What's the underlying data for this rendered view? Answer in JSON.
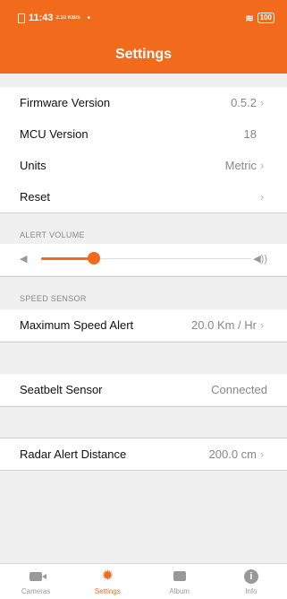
{
  "status_bar": {
    "time": "11:43",
    "net_speed": "2.10 KB/s",
    "dot": "•",
    "battery": "100",
    "wifi": "wifi-icon"
  },
  "header": {
    "title": "Settings"
  },
  "device_section": {
    "rows": [
      {
        "label": "Firmware Version",
        "value": "0.5.2"
      },
      {
        "label": "MCU Version",
        "value": "18"
      },
      {
        "label": "Units",
        "value": "Metric"
      },
      {
        "label": "Reset",
        "value": ""
      }
    ]
  },
  "alert_volume": {
    "heading": "ALERT VOLUME",
    "level": 0.25
  },
  "speed_sensor": {
    "heading": "SPEED SENSOR",
    "label": "Maximum Speed Alert",
    "value": "20.0 Km / Hr"
  },
  "seatbelt": {
    "label": "Seatbelt Sensor",
    "value": "Connected"
  },
  "radar": {
    "label": "Radar Alert Distance",
    "value": "200.0 cm"
  },
  "chevron": "›",
  "tabs": [
    {
      "label": "Cameras",
      "icon": "camera-icon"
    },
    {
      "label": "Settings",
      "icon": "gear-icon",
      "active": true
    },
    {
      "label": "Album",
      "icon": "album-icon"
    },
    {
      "label": "Info",
      "icon": "info-icon"
    }
  ],
  "colors": {
    "accent": "#f26a1b",
    "background": "#f0f0f0"
  }
}
